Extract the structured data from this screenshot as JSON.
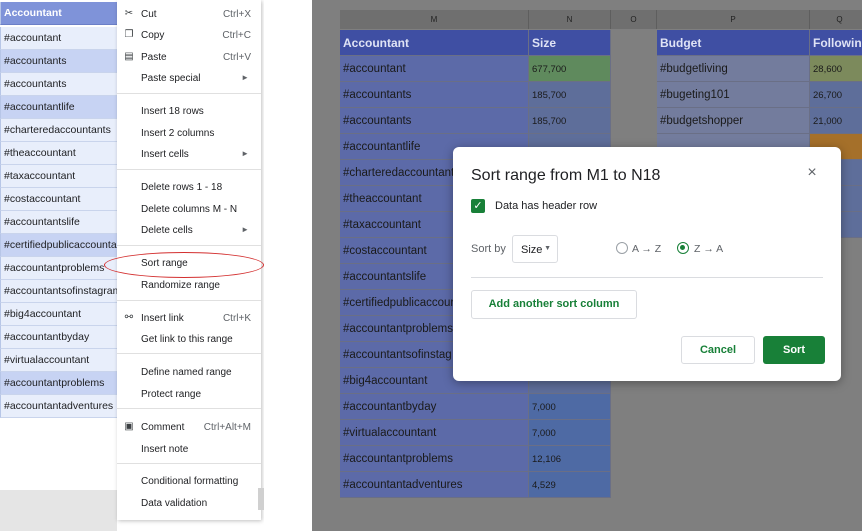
{
  "left": {
    "column_header": "Accountant",
    "rows": [
      "#accountant",
      "#accountants",
      "#accountants",
      "#accountantlife",
      "#charteredaccountants",
      "#theaccountant",
      "#taxaccountant",
      "#costaccountant",
      "#accountantslife",
      "#certifiedpublicaccountant",
      "#accountantproblems",
      "#accountantsofinstagram",
      "#big4accountant",
      "#accountantbyday",
      "#virtualaccountant",
      "#accountantproblems",
      "#accountantadventures"
    ]
  },
  "context_menu": {
    "items": [
      {
        "label": "Cut",
        "shortcut": "Ctrl+X",
        "icon": "scissors-icon"
      },
      {
        "label": "Copy",
        "shortcut": "Ctrl+C",
        "icon": "copy-icon"
      },
      {
        "label": "Paste",
        "shortcut": "Ctrl+V",
        "icon": "paste-icon"
      },
      {
        "label": "Paste special",
        "submenu": true
      },
      {
        "label": "Insert 18 rows"
      },
      {
        "label": "Insert 2 columns"
      },
      {
        "label": "Insert cells",
        "submenu": true
      },
      {
        "label": "Delete rows 1 - 18"
      },
      {
        "label": "Delete columns M - N"
      },
      {
        "label": "Delete cells",
        "submenu": true
      },
      {
        "label": "Sort range",
        "highlighted": true
      },
      {
        "label": "Randomize range"
      },
      {
        "label": "Insert link",
        "shortcut": "Ctrl+K",
        "icon": "link-icon"
      },
      {
        "label": "Get link to this range"
      },
      {
        "label": "Define named range"
      },
      {
        "label": "Protect range"
      },
      {
        "label": "Comment",
        "shortcut": "Ctrl+Alt+M",
        "icon": "comment-icon"
      },
      {
        "label": "Insert note"
      },
      {
        "label": "Conditional formatting"
      },
      {
        "label": "Data validation"
      }
    ],
    "submenu_glyph": "►",
    "highlight_color": "#d32f2f"
  },
  "sheet": {
    "column_letters": {
      "M": "M",
      "N": "N",
      "O": "O",
      "P": "P",
      "Q": "Q"
    },
    "headers": {
      "accountant": "Accountant",
      "size": "Size",
      "budget": "Budget",
      "following": "Followin"
    },
    "rows": [
      {
        "m": "#accountant",
        "n": "677,700",
        "p": "#budgetliving",
        "q": "28,600"
      },
      {
        "m": "#accountants",
        "n": "185,700",
        "p": "#bugeting101",
        "q": "26,700"
      },
      {
        "m": "#accountants",
        "n": "185,700",
        "p": "#budgetshopper",
        "q": "21,000"
      },
      {
        "m": "#accountantlife",
        "n": "",
        "p": "",
        "q": ""
      },
      {
        "m": "#charteredaccountant",
        "n": "",
        "p": "",
        "q": ""
      },
      {
        "m": "#theaccountant",
        "n": "",
        "p": "",
        "q": ""
      },
      {
        "m": "#taxaccountant",
        "n": "",
        "p": "",
        "q": ""
      },
      {
        "m": "#costaccountant",
        "n": "",
        "p": "",
        "q": ""
      },
      {
        "m": "#accountantslife",
        "n": "",
        "p": "",
        "q": ""
      },
      {
        "m": "#certifiedpublicaccour",
        "n": "",
        "p": "",
        "q": ""
      },
      {
        "m": "#accountantproblems",
        "n": "",
        "p": "",
        "q": ""
      },
      {
        "m": "#accountantsofinstag",
        "n": "",
        "p": "",
        "q": ""
      },
      {
        "m": "#big4accountant",
        "n": "",
        "p": "",
        "q": ""
      },
      {
        "m": "#accountantbyday",
        "n": "7,000",
        "p": "",
        "q": ""
      },
      {
        "m": "#virtualaccountant",
        "n": "7,000",
        "p": "",
        "q": ""
      },
      {
        "m": "#accountantproblems",
        "n": "12,106",
        "p": "",
        "q": ""
      },
      {
        "m": "#accountantadventures",
        "n": "4,529",
        "p": "",
        "q": ""
      }
    ],
    "colors": {
      "size_top": "#5f8a5d",
      "size_mid": "#5e6e9a",
      "size_low": "#4e6aa4",
      "following_top": "#7c8a5c",
      "following_orange": "#a5702a"
    }
  },
  "dialog": {
    "title": "Sort range from M1 to N18",
    "close_icon": "×",
    "header_checkbox_label": "Data has header row",
    "header_checkbox_checked": true,
    "sort_by_label": "Sort by",
    "sort_column": "Size",
    "order_options": [
      {
        "label": "A → Z",
        "selected": false
      },
      {
        "label": "Z → A",
        "selected": true
      }
    ],
    "add_column_label": "Add another sort column",
    "cancel_label": "Cancel",
    "sort_label": "Sort",
    "accent": "#188038"
  }
}
